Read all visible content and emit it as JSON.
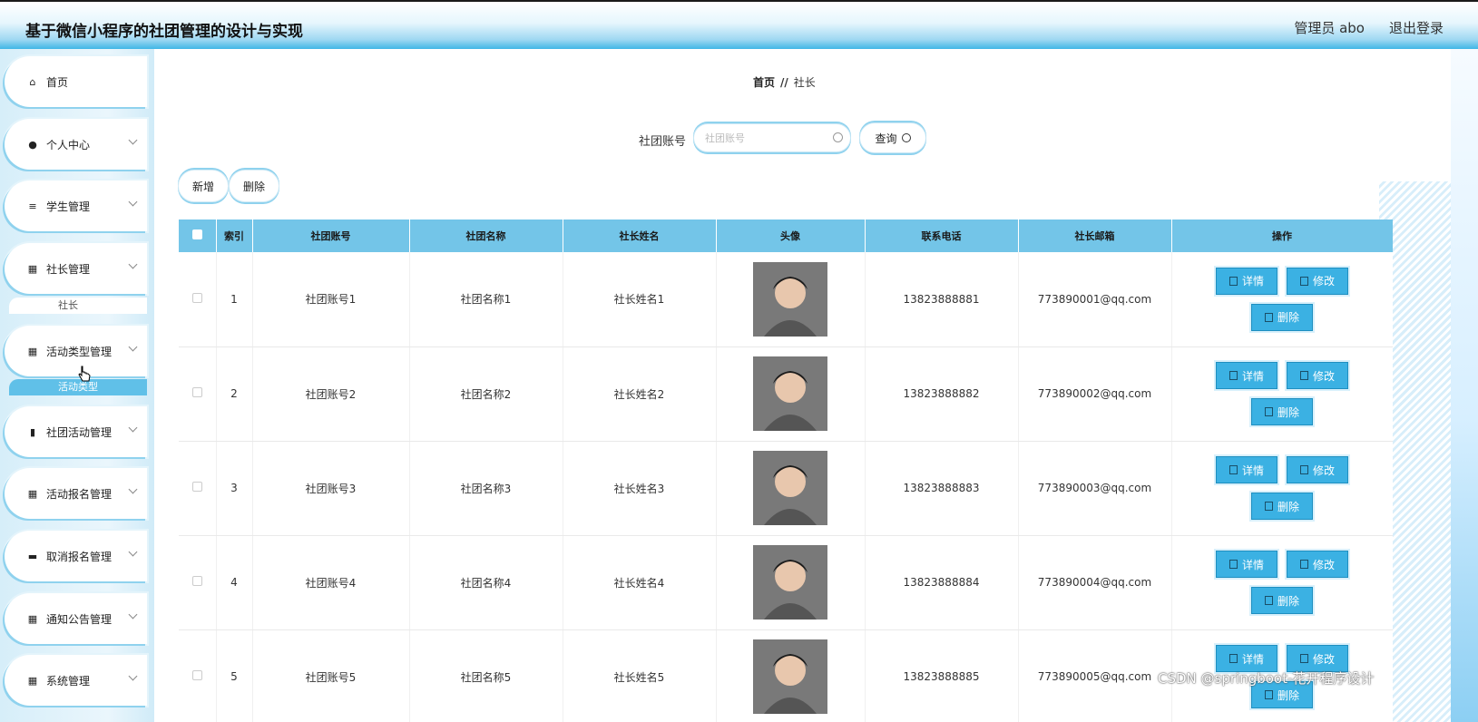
{
  "header": {
    "title": "基于微信小程序的社团管理的设计与实现",
    "user": "管理员 abo",
    "logout": "退出登录"
  },
  "sidebar": {
    "items": [
      {
        "label": "首页",
        "icon": "home-icon"
      },
      {
        "label": "个人中心",
        "icon": "user-icon"
      },
      {
        "label": "学生管理",
        "icon": "list-icon"
      },
      {
        "label": "社长管理",
        "icon": "grid-icon"
      },
      {
        "label": "活动类型管理",
        "icon": "grid-icon"
      },
      {
        "label": "社团活动管理",
        "icon": "bar-chart-icon"
      },
      {
        "label": "活动报名管理",
        "icon": "grid-icon"
      },
      {
        "label": "取消报名管理",
        "icon": "message-icon"
      },
      {
        "label": "通知公告管理",
        "icon": "grid-icon"
      },
      {
        "label": "系统管理",
        "icon": "grid-icon"
      }
    ],
    "sub_items": [
      "社长",
      "活动类型"
    ]
  },
  "breadcrumb": {
    "home": "首页",
    "sep": "//",
    "current": "社长"
  },
  "search": {
    "label": "社团账号",
    "placeholder": "社团账号",
    "button": "查询"
  },
  "actions": {
    "add": "新增",
    "delete": "删除"
  },
  "table": {
    "columns": [
      "索引",
      "社团账号",
      "社团名称",
      "社长姓名",
      "头像",
      "联系电话",
      "社长邮箱",
      "操作"
    ],
    "rows": [
      {
        "index": "1",
        "account": "社团账号1",
        "name": "社团名称1",
        "leader": "社长姓名1",
        "phone": "13823888881",
        "email": "773890001@qq.com"
      },
      {
        "index": "2",
        "account": "社团账号2",
        "name": "社团名称2",
        "leader": "社长姓名2",
        "phone": "13823888882",
        "email": "773890002@qq.com"
      },
      {
        "index": "3",
        "account": "社团账号3",
        "name": "社团名称3",
        "leader": "社长姓名3",
        "phone": "13823888883",
        "email": "773890003@qq.com"
      },
      {
        "index": "4",
        "account": "社团账号4",
        "name": "社团名称4",
        "leader": "社长姓名4",
        "phone": "13823888884",
        "email": "773890004@qq.com"
      },
      {
        "index": "5",
        "account": "社团账号5",
        "name": "社团名称5",
        "leader": "社长姓名5",
        "phone": "13823888885",
        "email": "773890005@qq.com"
      }
    ],
    "row_buttons": {
      "detail": "详情",
      "edit": "修改",
      "delete": "删除"
    }
  },
  "watermark": "CSDN @springboot-花开程序设计",
  "colors": {
    "accent": "#3bb1e3",
    "header_row": "#73c5e8",
    "sidebar_bg": "#d6eef9"
  }
}
